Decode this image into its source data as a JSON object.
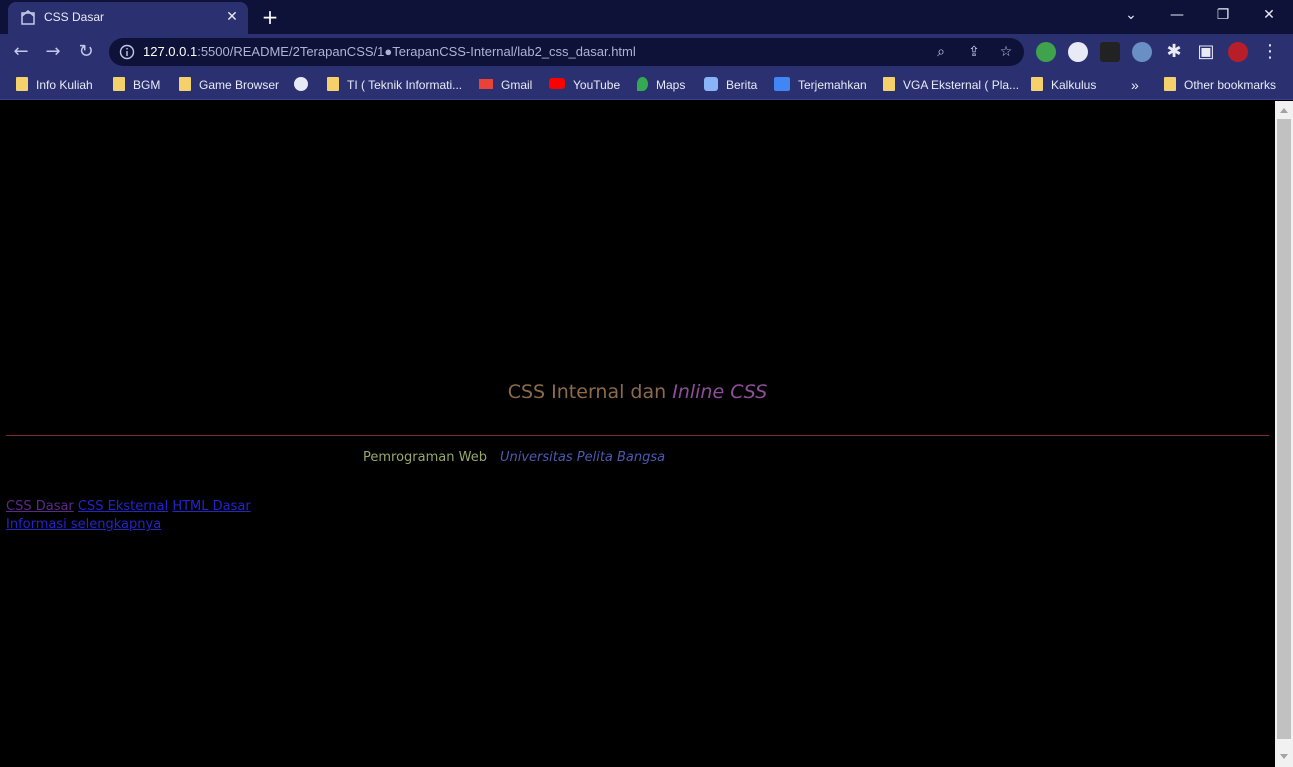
{
  "browser": {
    "tab_title": "CSS Dasar",
    "url_host": "127.0.0.1",
    "url_rest": ":5500/README/2TerapanCSS/1●TerapanCSS-Internal/lab2_css_dasar.html",
    "bookmarks": [
      {
        "label": "Info Kuliah",
        "icon": "folder-icon"
      },
      {
        "label": "BGM",
        "icon": "folder-icon"
      },
      {
        "label": "Game Browser",
        "icon": "folder-icon"
      },
      {
        "label": "",
        "icon": "globe-icon"
      },
      {
        "label": "TI ( Teknik Informati...",
        "icon": "folder-icon"
      },
      {
        "label": "Gmail",
        "icon": "gmail-icon"
      },
      {
        "label": "YouTube",
        "icon": "youtube-icon"
      },
      {
        "label": "Maps",
        "icon": "maps-icon"
      },
      {
        "label": "Berita",
        "icon": "news-icon"
      },
      {
        "label": "Terjemahkan",
        "icon": "translate-icon"
      },
      {
        "label": "VGA Eksternal ( Pla...",
        "icon": "folder-icon"
      },
      {
        "label": "Kalkulus",
        "icon": "folder-icon"
      }
    ],
    "overflow": "»",
    "other_bookmarks": "Other bookmarks"
  },
  "page": {
    "heading_plain": "CSS Internal dan ",
    "heading_italic": "Inline CSS",
    "subtitle_left": "Pemrograman Web",
    "subtitle_right": "Universitas Pelita Bangsa",
    "links": [
      "CSS Dasar",
      "CSS Eksternal",
      "HTML Dasar"
    ],
    "more_link": "Informasi selengkapnya"
  },
  "colors": {
    "heading": "#8b6b4b",
    "heading_italic": "#8e4e9a",
    "rule": "#7a3030",
    "subtitle_left": "#97a86a",
    "subtitle_right": "#4a5ab0"
  }
}
